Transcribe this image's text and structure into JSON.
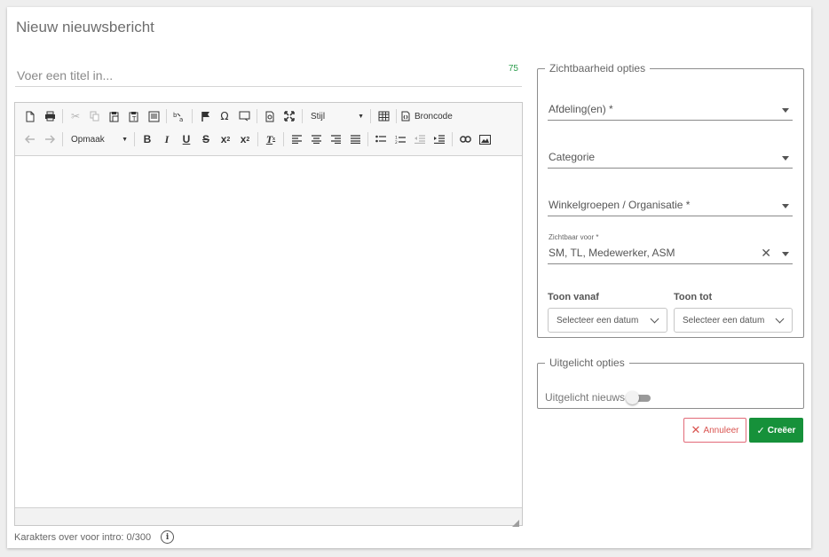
{
  "page": {
    "title": "Nieuw nieuwsbericht"
  },
  "title_field": {
    "placeholder": "Voer een titel in...",
    "value": "",
    "remaining": "75"
  },
  "editor": {
    "style_combo": "Stijl",
    "format_combo": "Opmaak",
    "source_label": "Broncode",
    "intro_counter": "Karakters over voor intro: 0/300"
  },
  "visibility": {
    "legend": "Zichtbaarheid opties",
    "department": "Afdeling(en) *",
    "category": "Categorie",
    "store_groups": "Winkelgroepen / Organisatie *",
    "visible_for_label": "Zichtbaar voor *",
    "visible_for_value": "SM, TL, Medewerker, ASM",
    "show_from_label": "Toon vanaf",
    "show_until_label": "Toon tot",
    "date_placeholder_from": "Selecteer een datum",
    "date_placeholder_until": "Selecteer een datum"
  },
  "featured": {
    "legend": "Uitgelicht opties",
    "toggle_label": "Uitgelicht nieuws",
    "toggle_on": false
  },
  "actions": {
    "cancel": "Annuleer",
    "create": "Creëer"
  },
  "colors": {
    "create_green": "#16913a",
    "cancel_red": "#d9534f",
    "counter_green": "#2e9e4f"
  }
}
